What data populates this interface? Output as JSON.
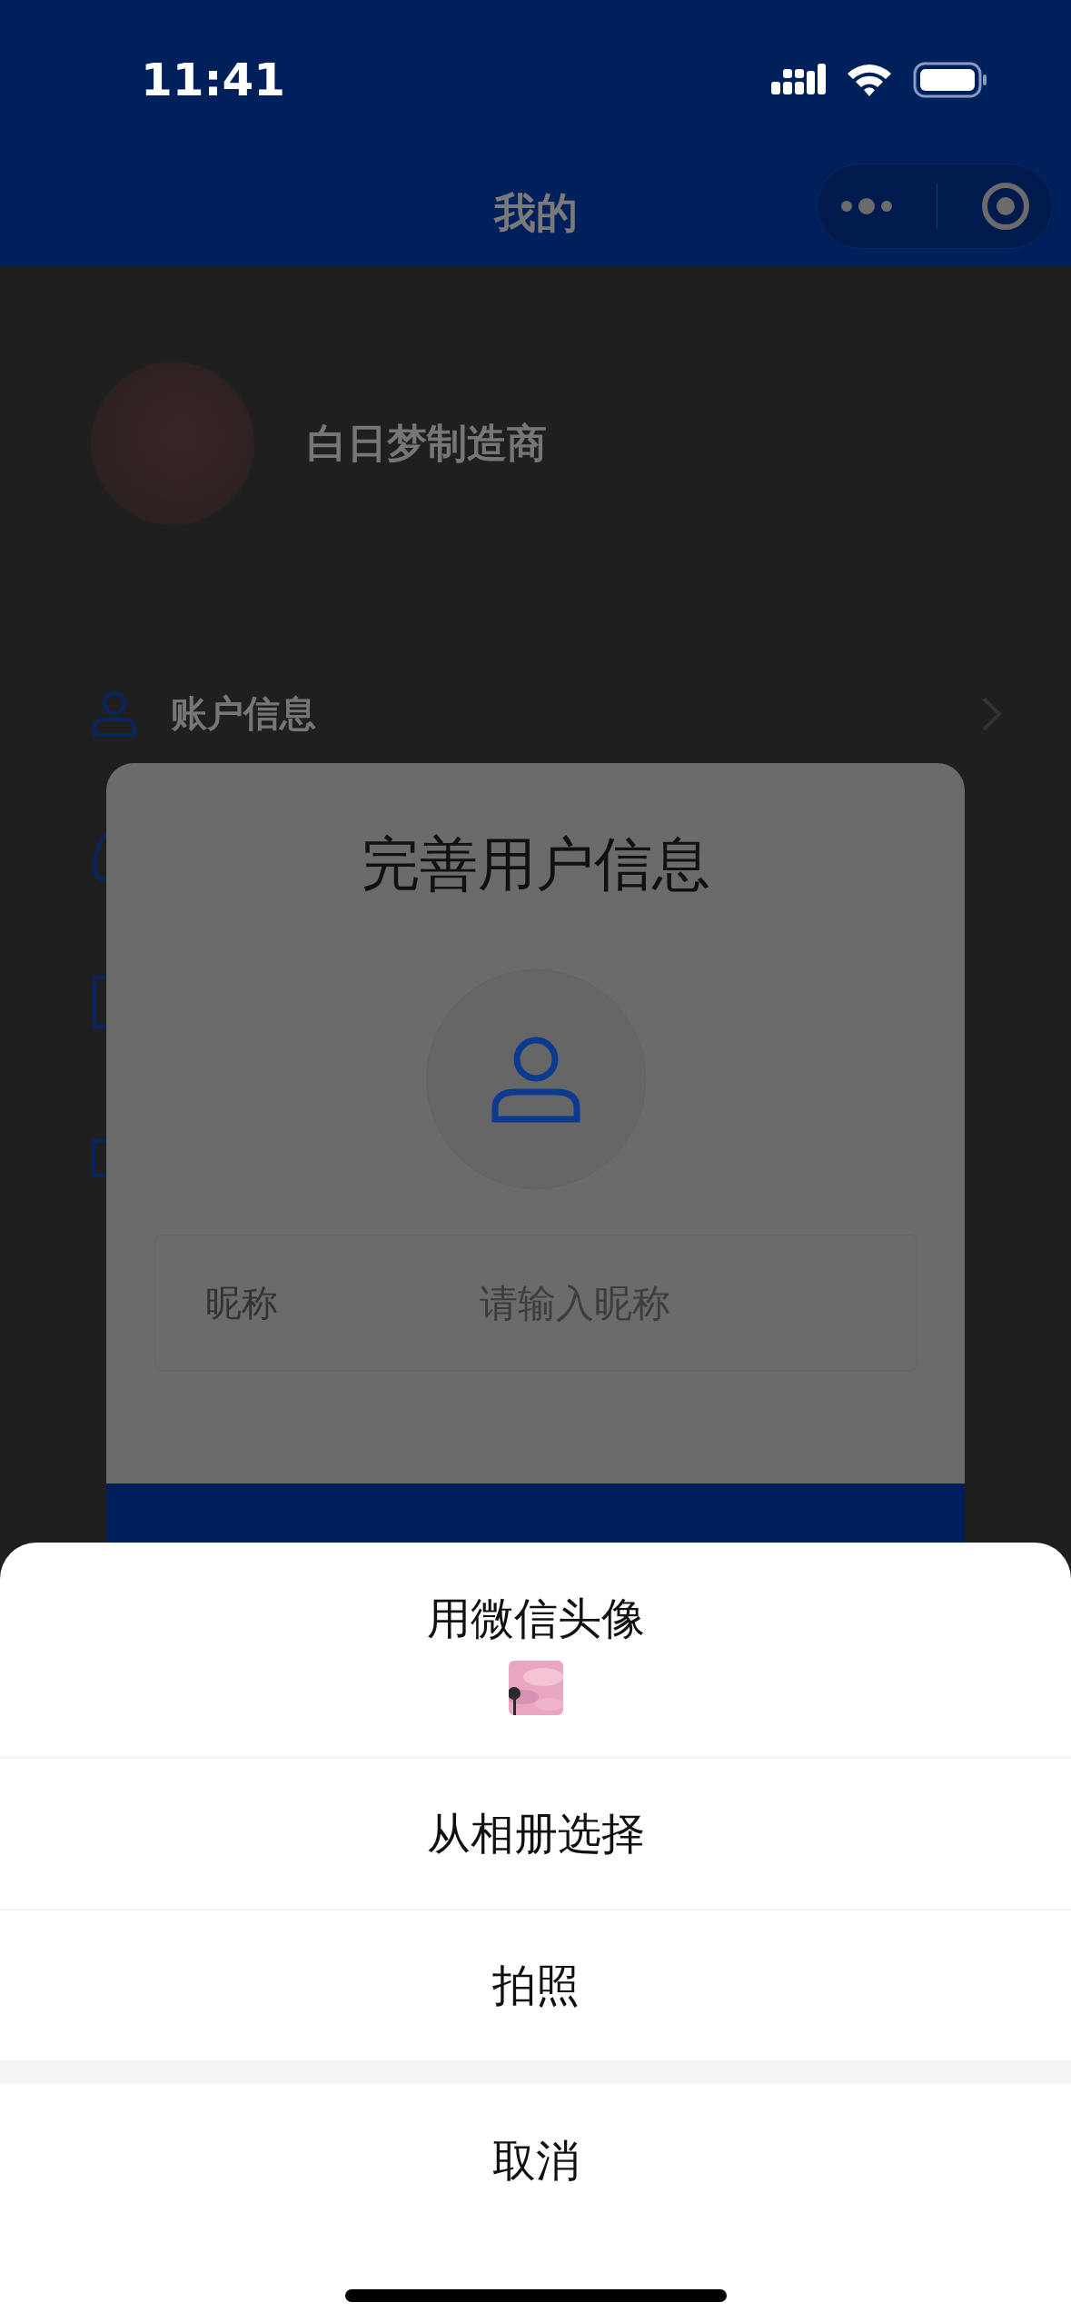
{
  "status_bar": {
    "time": "11:41"
  },
  "nav": {
    "title": "我的"
  },
  "profile": {
    "name": "白日梦制造商"
  },
  "menu": [
    {
      "label": "账户信息"
    }
  ],
  "dialog": {
    "title": "完善用户信息",
    "fields": [
      {
        "label": "昵称",
        "placeholder": "请输入昵称"
      }
    ]
  },
  "action_sheet": {
    "options": [
      {
        "label": "用微信头像",
        "kind": "with_picture"
      },
      {
        "label": "从相册选择",
        "kind": "plain"
      },
      {
        "label": "拍照",
        "kind": "plain"
      }
    ],
    "cancel": "取消"
  }
}
